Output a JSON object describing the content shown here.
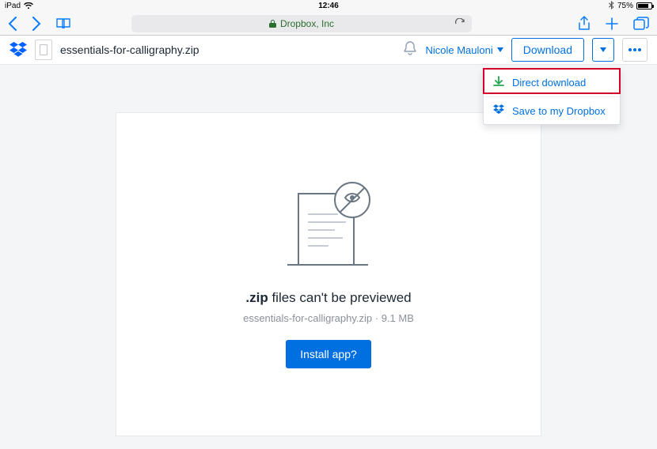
{
  "statusbar": {
    "device": "iPad",
    "time": "12:46",
    "battery_pct": "75%"
  },
  "safari": {
    "address_label": "Dropbox, Inc"
  },
  "dropbox": {
    "filename": "essentials-for-calligraphy.zip",
    "user": "Nicole Mauloni",
    "download_label": "Download",
    "dropdown": {
      "direct": "Direct download",
      "save": "Save to my Dropbox"
    }
  },
  "preview": {
    "ext": ".zip",
    "headline_rest": " files can't be previewed",
    "filename": "essentials-for-calligraphy.zip",
    "separator": " · ",
    "size": "9.1 MB",
    "install_label": "Install app?"
  }
}
